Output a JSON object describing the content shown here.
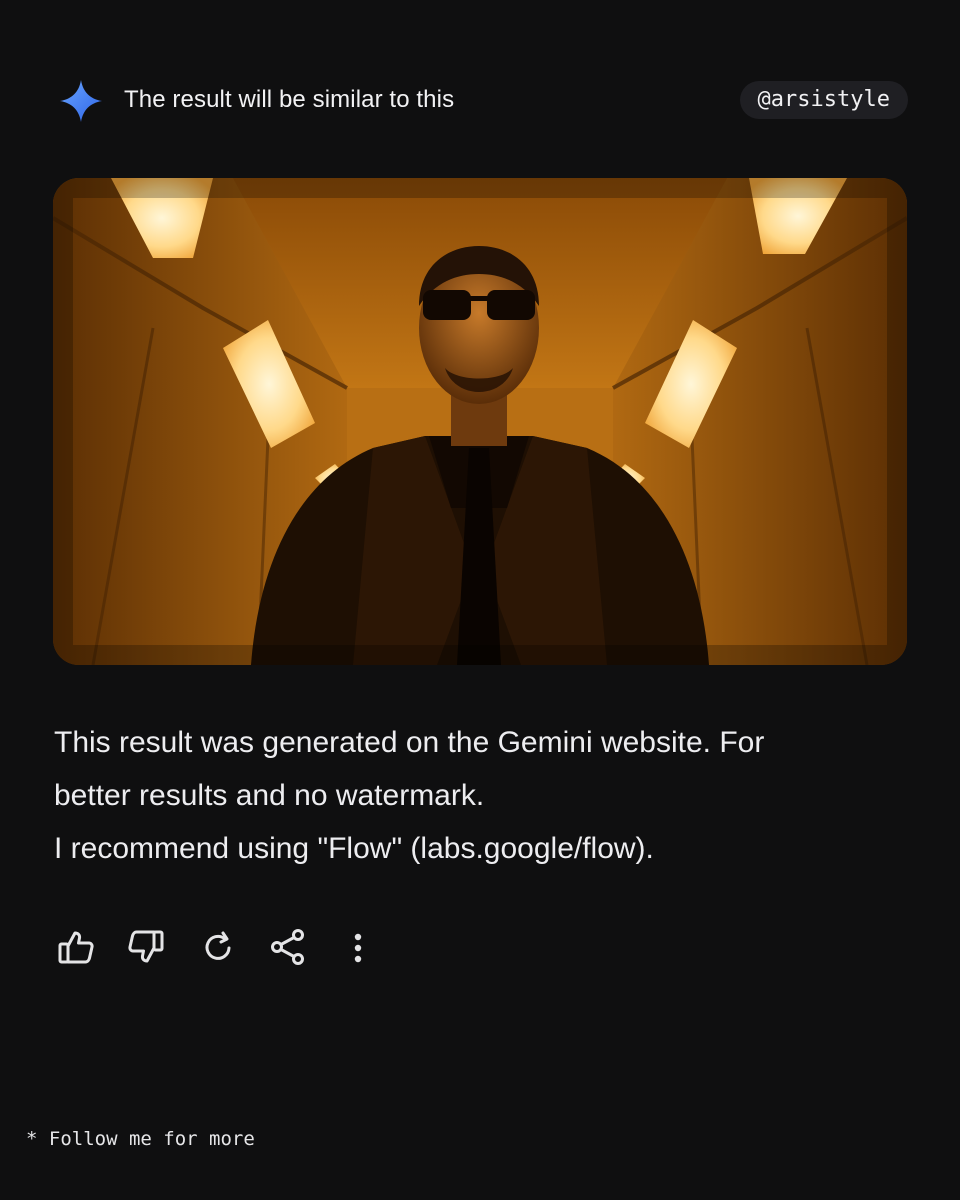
{
  "header": {
    "title": "The result will be similar to this",
    "handle": "@arsistyle",
    "logo_icon": "gemini-sparkle-icon",
    "accent_colors": [
      "#4f8ef7",
      "#2f6fe0"
    ]
  },
  "image": {
    "subject": "man in sunglasses and leather coat standing in an orange-lit concrete corridor"
  },
  "message": {
    "line1": "This result was generated on the Gemini website. For",
    "line2": "better results and no watermark.",
    "line3": "I recommend using \"Flow\" (labs.google/flow)."
  },
  "actions": [
    {
      "icon": "thumbs-up-icon"
    },
    {
      "icon": "thumbs-down-icon"
    },
    {
      "icon": "regenerate-icon"
    },
    {
      "icon": "share-icon"
    },
    {
      "icon": "more-vert-icon"
    }
  ],
  "footer": {
    "text": "* Follow me for more"
  }
}
